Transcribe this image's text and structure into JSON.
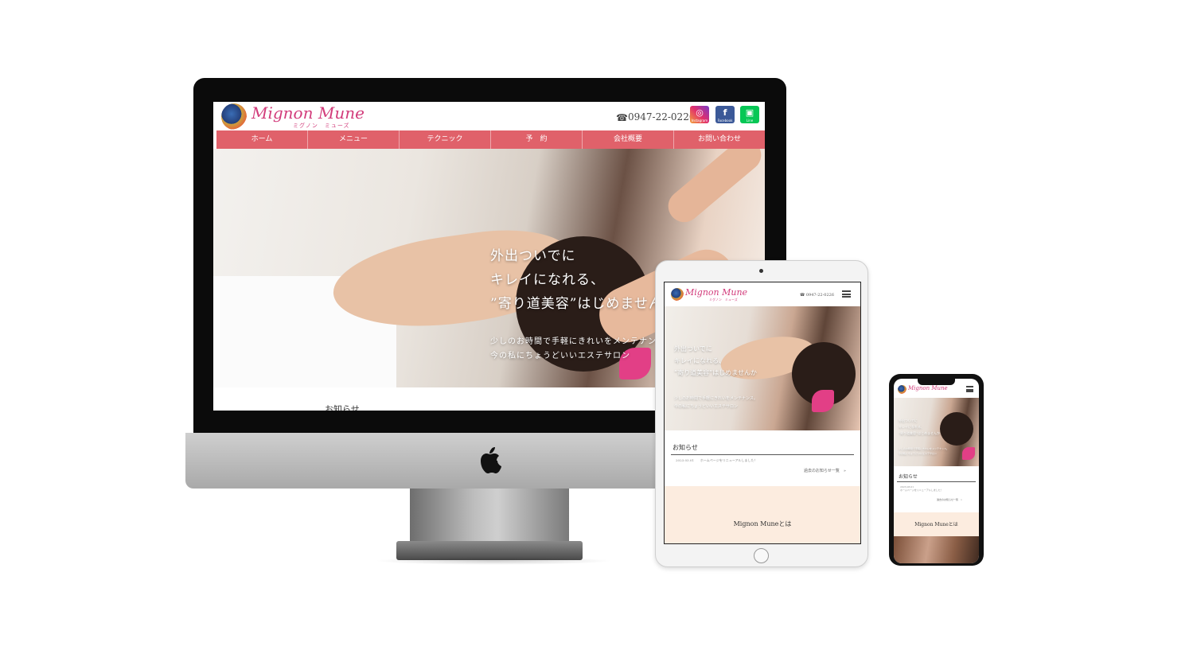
{
  "site": {
    "logo_text": "Mignon Mune",
    "logo_sub": "ミグノン　ミューズ",
    "phone": "0947-22-0226",
    "phone_icon": "phone-icon",
    "sns": [
      {
        "name": "instagram-icon",
        "caption": "Instagram",
        "glyph": "◎",
        "color": "#e1306c"
      },
      {
        "name": "facebook-icon",
        "caption": "Facebook",
        "glyph": "f",
        "color": "#3b5998"
      },
      {
        "name": "line-icon",
        "caption": "Line",
        "glyph": "▣",
        "color": "#06c755"
      }
    ],
    "nav": [
      "ホーム",
      "メニュー",
      "テクニック",
      "予　約",
      "会社概要",
      "お問い合わせ"
    ],
    "accent_color": "#e0616a",
    "hero": {
      "line1": "外出ついでに",
      "line2": "キレイになれる、",
      "line3": "”寄り道美容”はじめませんか",
      "sub1": "少しのお時間で手軽にきれいをメンテナンス。",
      "sub2": "今の私にちょうどいいエステサロン"
    },
    "news_heading": "お知らせ"
  },
  "tablet": {
    "phone": "0947-22-0226",
    "hero_line1": "外出ついでに",
    "hero_line2": "キレイになれる、",
    "hero_line3": "”寄り道美容”はじめませんか",
    "hero_sub1": "少しのお時間で手軽にきれいをメンテナンス。",
    "hero_sub2": "今の私にちょうどいいエステサロン",
    "news_heading": "お知らせ",
    "news_date": "2023.03.01",
    "news_title": "ホームページをリニューアルしました！",
    "news_more": "過去のお知らせ一覧　»",
    "about_heading": "Mignon Muneとは"
  },
  "phone": {
    "hero_line1": "外出ついでに",
    "hero_line2": "キレイになれる、",
    "hero_line3": "”寄り道美容”はじめませんか",
    "hero_sub1": "少しのお時間で手軽にきれいをメンテナンス。",
    "hero_sub2": "今の私にちょうどいいエステサロン",
    "news_heading": "お知らせ",
    "news_date": "2023.03.01",
    "news_title": "ホームページをリニューアルしました！",
    "news_more": "過去のお知らせ一覧　»",
    "about_heading": "Mignon Muneとは"
  }
}
